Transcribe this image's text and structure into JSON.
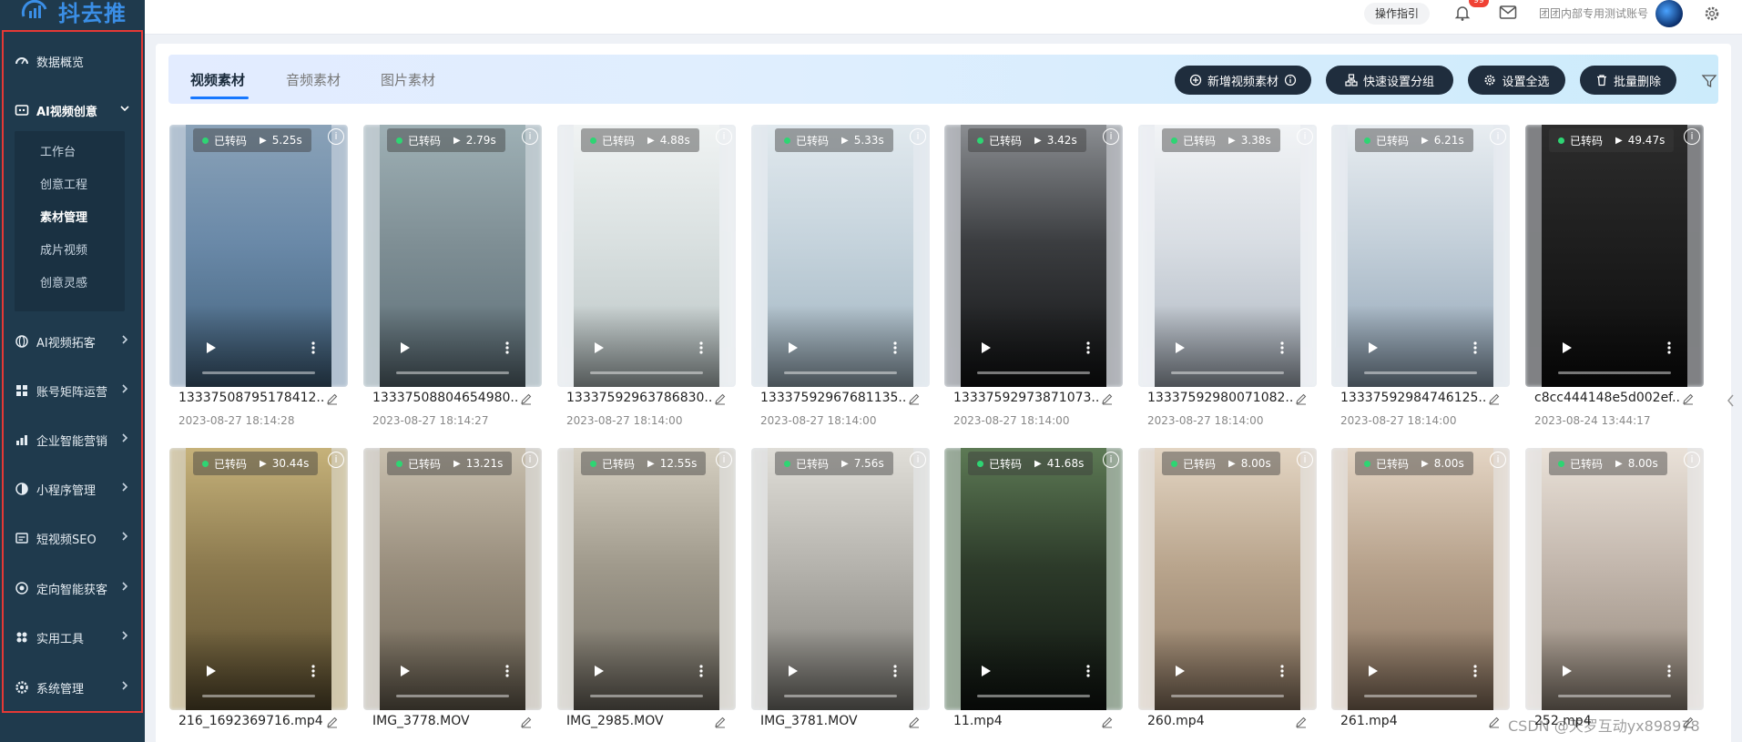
{
  "app": {
    "logo_text": "抖去推"
  },
  "sidebar": {
    "items": [
      {
        "label": "数据概览",
        "icon": "dashboard-icon",
        "active": false,
        "expandable": false
      },
      {
        "label": "AI视频创意",
        "icon": "video-ai-icon",
        "active": true,
        "expanded": true
      },
      {
        "label": "AI视频拓客",
        "icon": "globe-icon",
        "active": false,
        "expandable": true
      },
      {
        "label": "账号矩阵运营",
        "icon": "matrix-icon",
        "active": false,
        "expandable": true
      },
      {
        "label": "企业智能营销",
        "icon": "bar-chart-icon",
        "active": false,
        "expandable": true
      },
      {
        "label": "小程序管理",
        "icon": "miniapp-icon",
        "active": false,
        "expandable": true
      },
      {
        "label": "短视频SEO",
        "icon": "seo-icon",
        "active": false,
        "expandable": true
      },
      {
        "label": "定向智能获客",
        "icon": "target-icon",
        "active": false,
        "expandable": true
      },
      {
        "label": "实用工具",
        "icon": "tools-icon",
        "active": false,
        "expandable": true
      },
      {
        "label": "系统管理",
        "icon": "gear-icon",
        "active": false,
        "expandable": true
      }
    ],
    "submenu": [
      {
        "label": "工作台",
        "active": false
      },
      {
        "label": "创意工程",
        "active": false
      },
      {
        "label": "素材管理",
        "active": true
      },
      {
        "label": "成片视频",
        "active": false
      },
      {
        "label": "创意灵感",
        "active": false
      }
    ]
  },
  "header": {
    "guide_label": "操作指引",
    "notification_count": "99",
    "account_label": "团团内部专用测试账号"
  },
  "tabs": [
    {
      "label": "视频素材",
      "active": true
    },
    {
      "label": "音频素材",
      "active": false
    },
    {
      "label": "图片素材",
      "active": false
    }
  ],
  "toolbar": {
    "add_video": "新增视频素材",
    "quick_group": "快速设置分组",
    "select_all": "设置全选",
    "batch_delete": "批量删除"
  },
  "colors": {
    "sidebar_bg": "#1f3a4d",
    "accent": "#1677ff",
    "toolbar_button_bg": "#1f2d3d",
    "status_green": "#2ed573",
    "highlight_frame": "#e53935"
  },
  "videos": [
    {
      "status": "已转码",
      "duration": "5.25s",
      "name": "13337508795178412....",
      "date": "2023-08-27 18:14:28"
    },
    {
      "status": "已转码",
      "duration": "2.79s",
      "name": "13337508804654980....",
      "date": "2023-08-27 18:14:27"
    },
    {
      "status": "已转码",
      "duration": "4.88s",
      "name": "13337592963786830....",
      "date": "2023-08-27 18:14:00"
    },
    {
      "status": "已转码",
      "duration": "5.33s",
      "name": "13337592967681135....",
      "date": "2023-08-27 18:14:00"
    },
    {
      "status": "已转码",
      "duration": "3.42s",
      "name": "13337592973871073....",
      "date": "2023-08-27 18:14:00"
    },
    {
      "status": "已转码",
      "duration": "3.38s",
      "name": "13337592980071082....",
      "date": "2023-08-27 18:14:00"
    },
    {
      "status": "已转码",
      "duration": "6.21s",
      "name": "13337592984746125....",
      "date": "2023-08-27 18:14:00"
    },
    {
      "status": "已转码",
      "duration": "49.47s",
      "name": "c8cc444148e5d002ef...",
      "date": "2023-08-24 13:44:17"
    },
    {
      "status": "已转码",
      "duration": "30.44s",
      "name": "216_1692369716.mp4",
      "date": ""
    },
    {
      "status": "已转码",
      "duration": "13.21s",
      "name": "IMG_3778.MOV",
      "date": ""
    },
    {
      "status": "已转码",
      "duration": "12.55s",
      "name": "IMG_2985.MOV",
      "date": ""
    },
    {
      "status": "已转码",
      "duration": "7.56s",
      "name": "IMG_3781.MOV",
      "date": ""
    },
    {
      "status": "已转码",
      "duration": "41.68s",
      "name": "11.mp4",
      "date": ""
    },
    {
      "status": "已转码",
      "duration": "8.00s",
      "name": "260.mp4",
      "date": ""
    },
    {
      "status": "已转码",
      "duration": "8.00s",
      "name": "261.mp4",
      "date": ""
    },
    {
      "status": "已转码",
      "duration": "8.00s",
      "name": "252.mp4",
      "date": ""
    }
  ],
  "watermark": "CSDN @天罗互动yx898978"
}
